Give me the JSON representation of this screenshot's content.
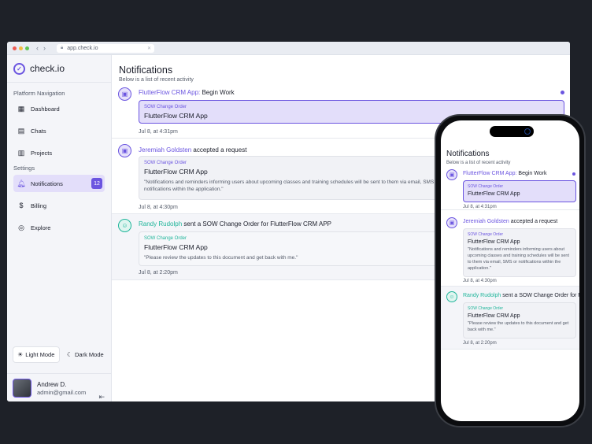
{
  "browser": {
    "url": "app.check.io"
  },
  "brand": {
    "name": "check.io"
  },
  "sidebar": {
    "platform_label": "Platform Navigation",
    "settings_label": "Settings",
    "items": [
      {
        "label": "Dashboard"
      },
      {
        "label": "Chats"
      },
      {
        "label": "Projects"
      },
      {
        "label": "Notifications",
        "badge": "12"
      },
      {
        "label": "Billing"
      },
      {
        "label": "Explore"
      }
    ],
    "light_mode": "Light Mode",
    "dark_mode": "Dark Mode"
  },
  "user": {
    "name": "Andrew D.",
    "email": "admin@gmail.com"
  },
  "page": {
    "title": "Notifications",
    "subtitle": "Below is a list of recent activity"
  },
  "notifications": [
    {
      "actor": "FlutterFlow CRM App:",
      "action": " Begin Work",
      "tag": "SOW Change Order",
      "card_title": "FlutterFlow CRM App",
      "body": "",
      "time": "Jul 8, at 4:31pm"
    },
    {
      "actor": "Jeremiah Goldsten",
      "action": " accepted a request",
      "tag": "SOW Change Order",
      "card_title": "FlutterFlow CRM App",
      "body": "\"Notifications and reminders informing users about upcoming classes and training schedules will be sent to them via email, SMS or notifications within the application.\"",
      "body_desktop": "\"Notifications and reminders informing users about upcoming classes and training schedules will be sent to them via email, SMS or notifications within the application.\"",
      "time": "Jul 8, at 4:30pm"
    },
    {
      "actor": "Randy Rudolph",
      "action": " sent a SOW Change Order for FlutterFlow CRM APP",
      "tag": "SOW Change Order",
      "card_title": "FlutterFlow CRM App",
      "body": "\"Please review the updates to this document and get back with me.\"",
      "time": "Jul 8, at 2:20pm"
    }
  ],
  "colors": {
    "accent": "#6b55e0",
    "teal": "#1fb59a",
    "background": "#1e2128"
  }
}
